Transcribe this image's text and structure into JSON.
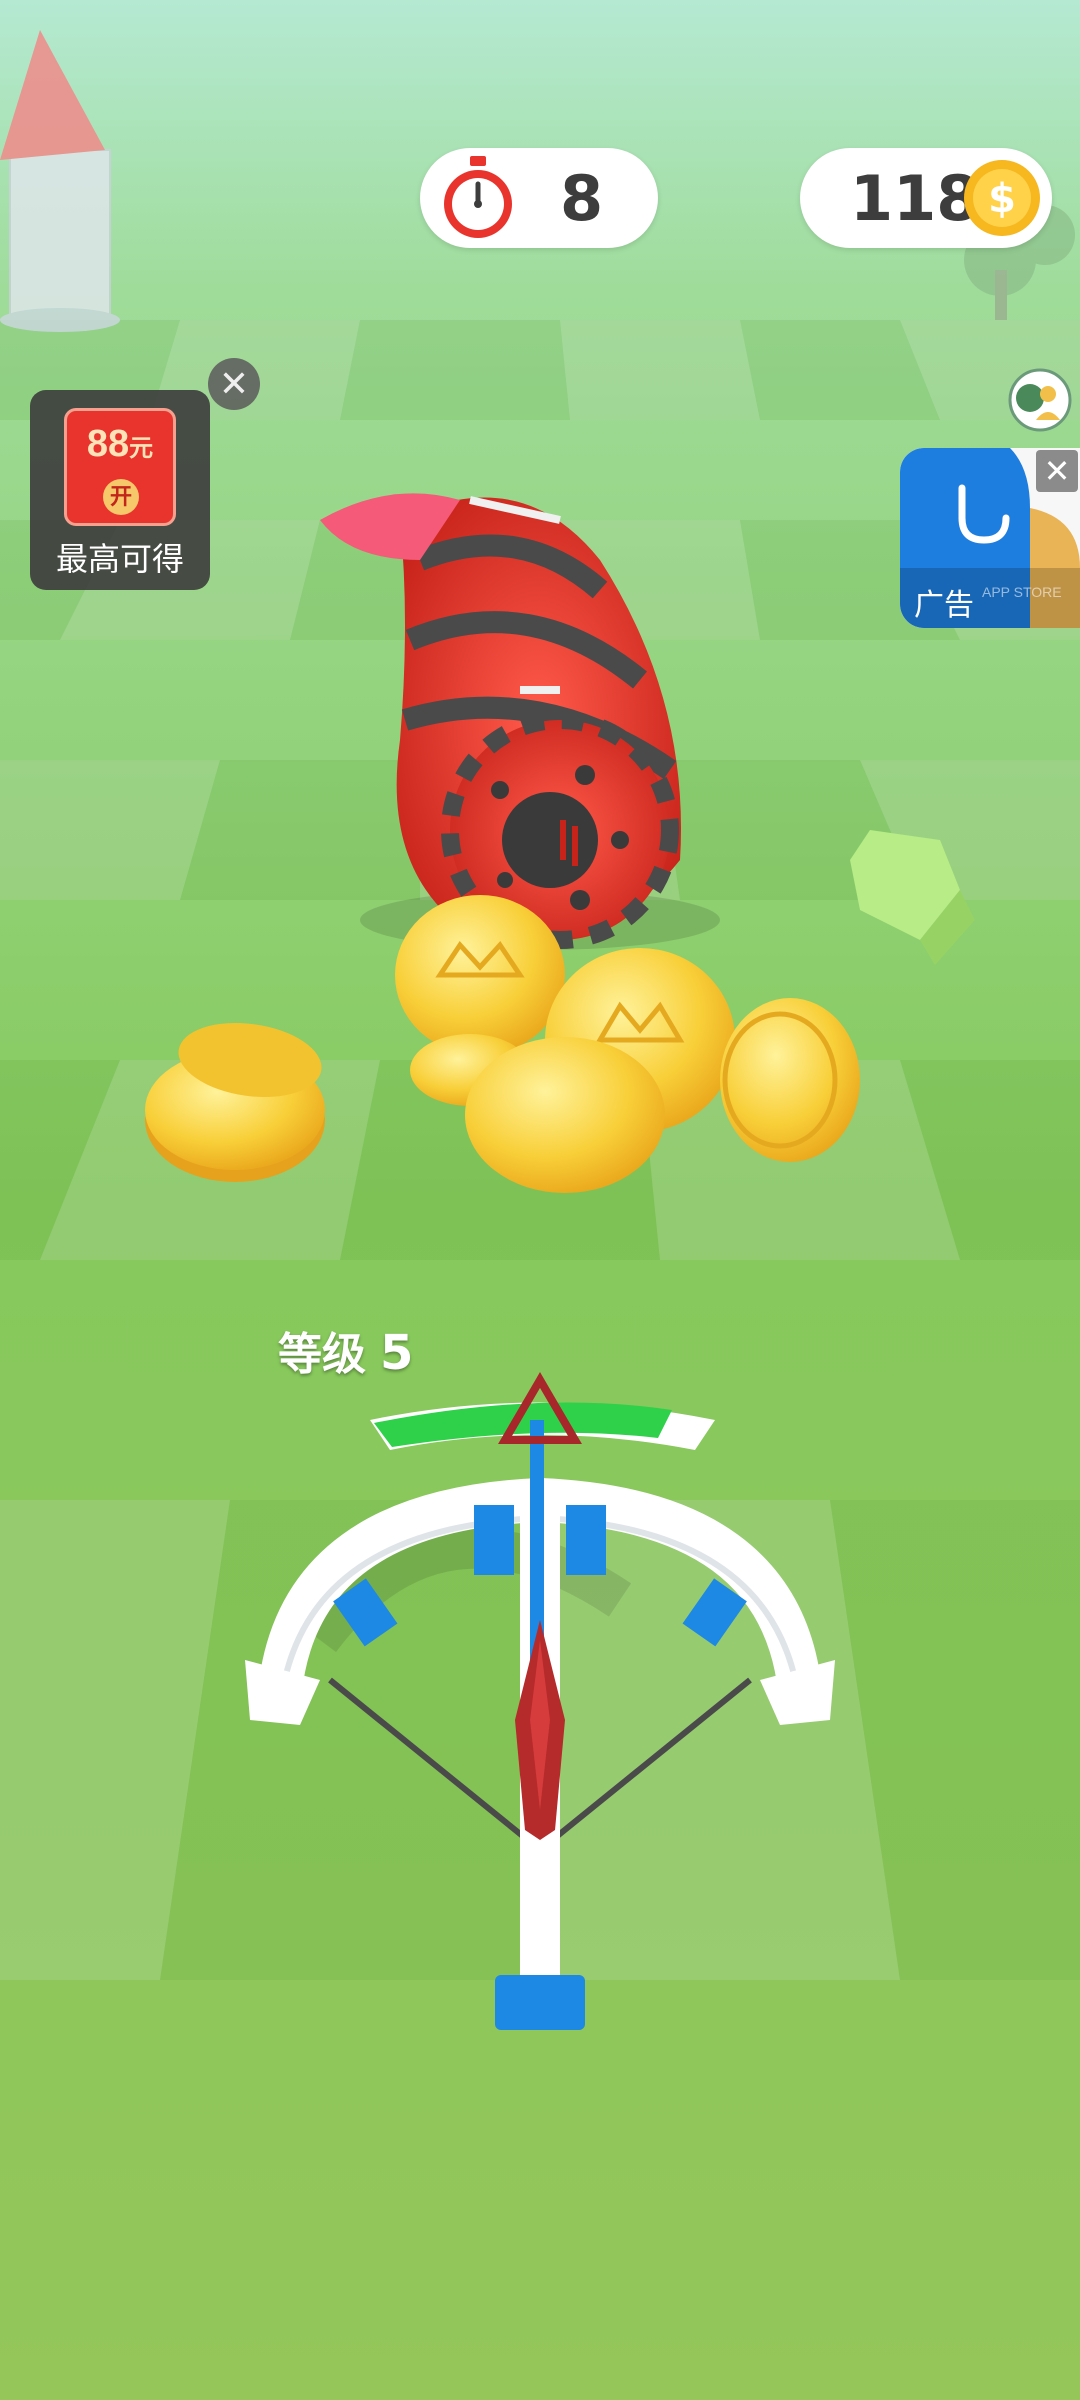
{
  "hud": {
    "timer_value": "8",
    "coin_value": "118",
    "icons": {
      "timer": "stopwatch-icon",
      "coins": "coin-icon"
    }
  },
  "redpacket": {
    "amount": "88",
    "unit": "元",
    "open_label": "开",
    "caption": "最高可得"
  },
  "ad": {
    "label": "广告",
    "store_text": "APP STORE"
  },
  "level": {
    "label": "等级",
    "number": "5",
    "progress": 0.85
  },
  "colors": {
    "progress_fill": "#2fd14a",
    "enemy_red": "#e63b2f",
    "coin_gold": "#f7c533",
    "crossbow_blue": "#1e88e5"
  }
}
